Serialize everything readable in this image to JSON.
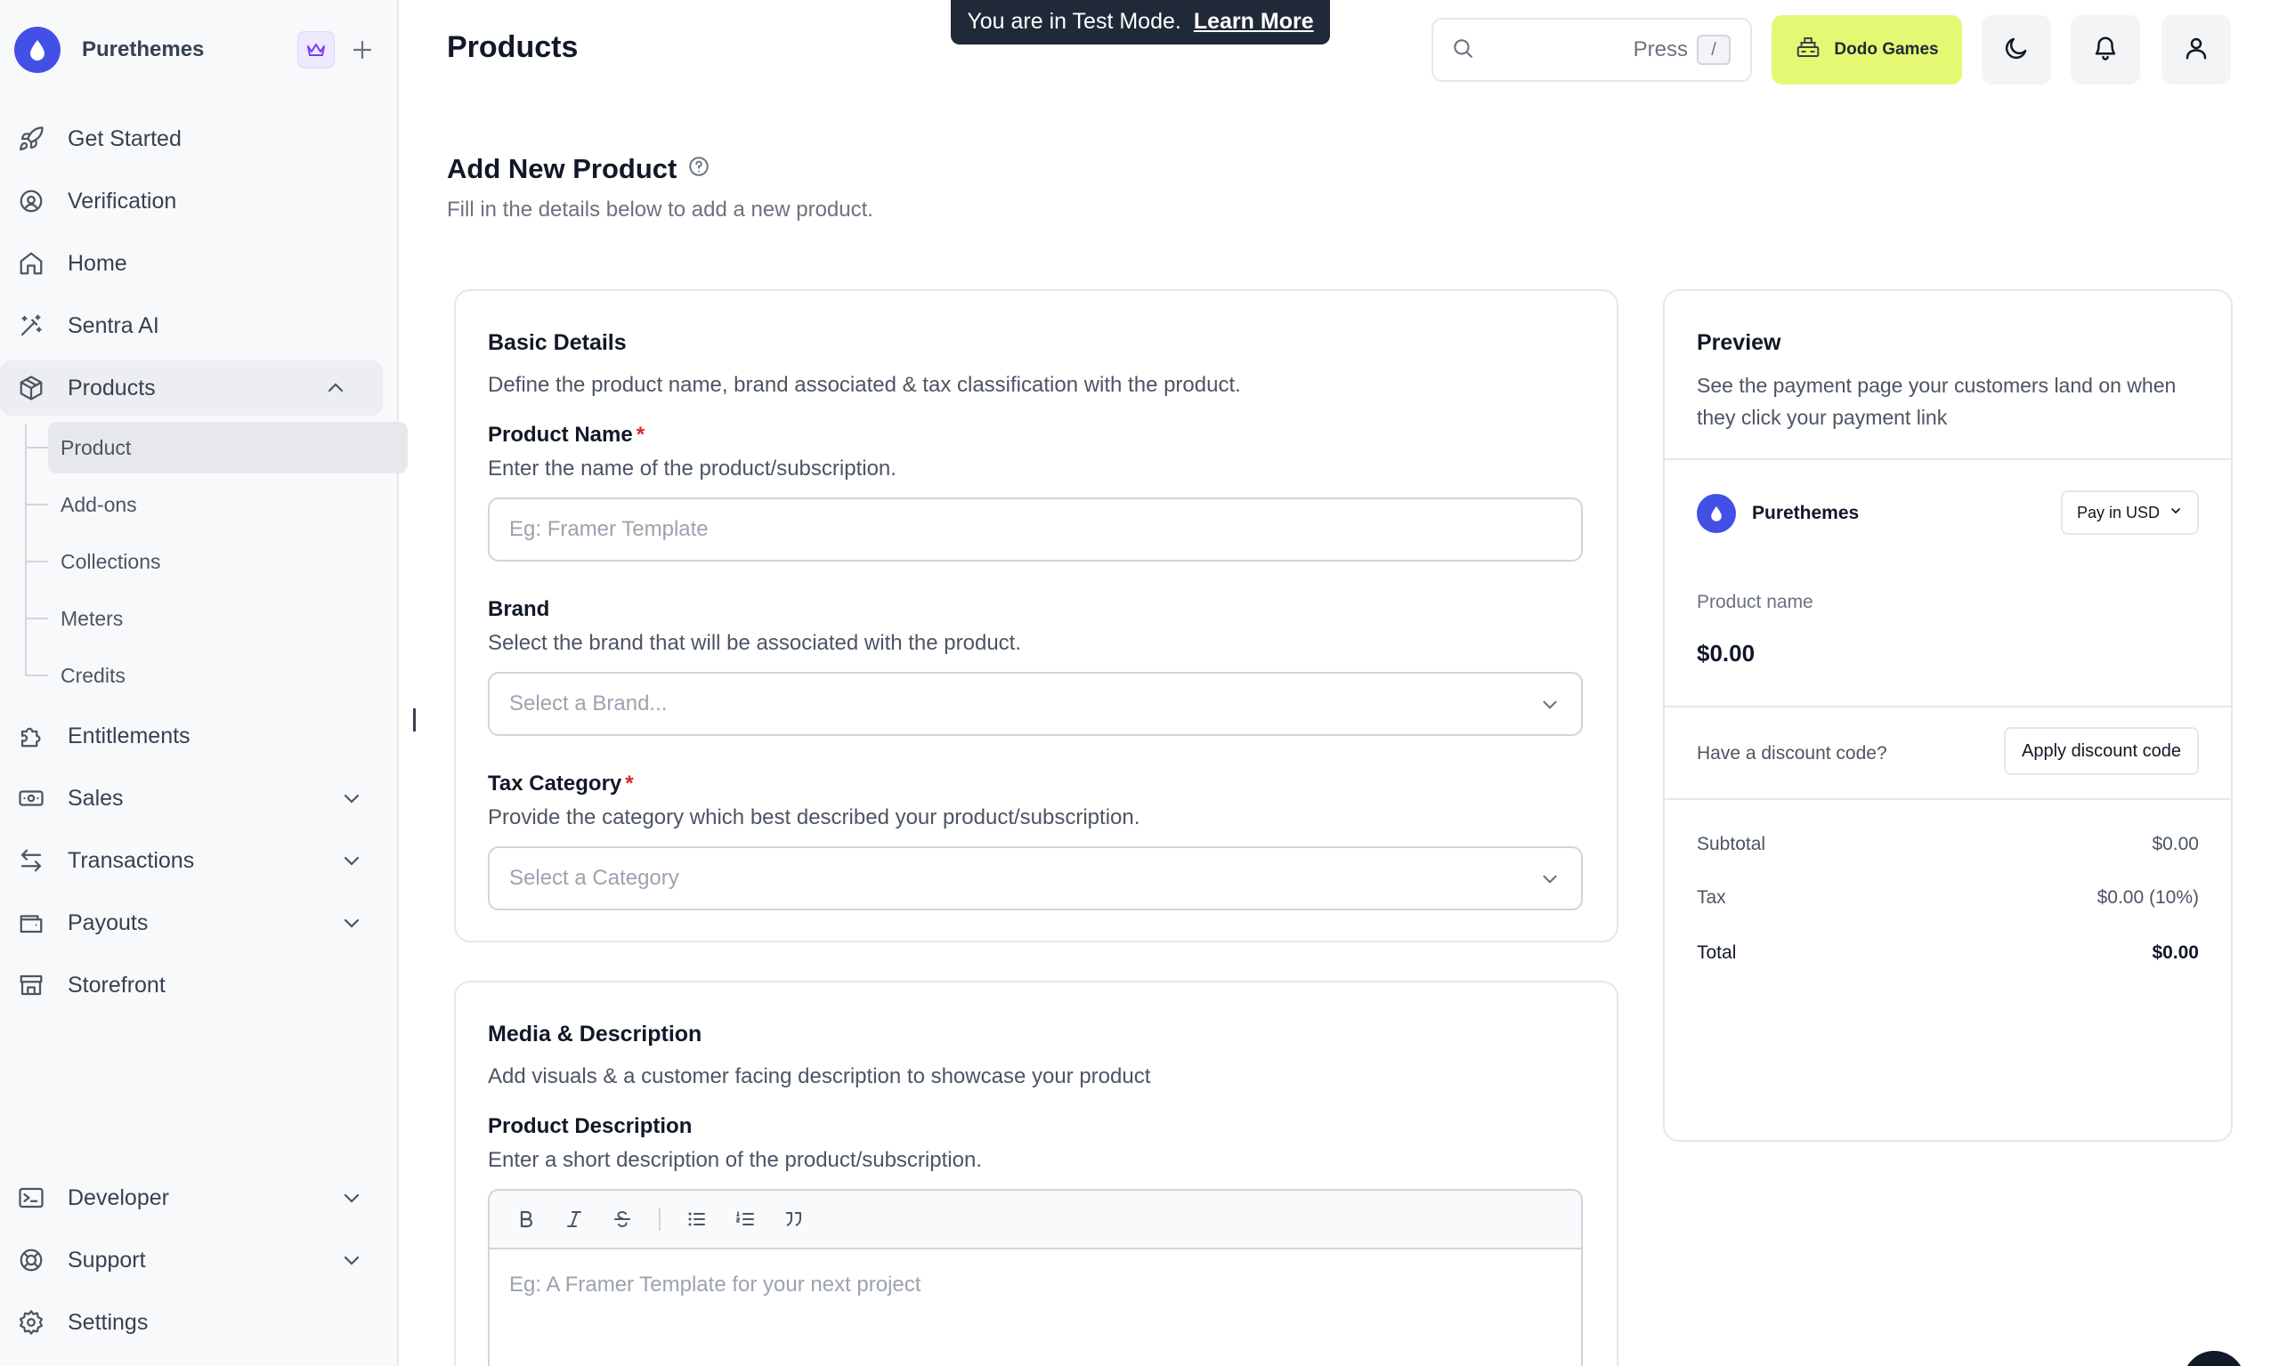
{
  "workspace": {
    "name": "Purethemes"
  },
  "sidebar": {
    "items": [
      {
        "label": "Get Started",
        "icon": "rocket-icon"
      },
      {
        "label": "Verification",
        "icon": "verification-icon"
      },
      {
        "label": "Home",
        "icon": "home-icon"
      },
      {
        "label": "Sentra AI",
        "icon": "magic-wand-icon"
      },
      {
        "label": "Products",
        "icon": "box-icon"
      },
      {
        "label": "Entitlements",
        "icon": "puzzle-icon"
      },
      {
        "label": "Sales",
        "icon": "banknote-icon"
      },
      {
        "label": "Transactions",
        "icon": "arrows-icon"
      },
      {
        "label": "Payouts",
        "icon": "wallet-icon"
      },
      {
        "label": "Storefront",
        "icon": "store-icon"
      },
      {
        "label": "Developer",
        "icon": "terminal-icon"
      },
      {
        "label": "Support",
        "icon": "lifebuoy-icon"
      },
      {
        "label": "Settings",
        "icon": "gear-icon"
      }
    ],
    "products_sub": [
      "Product",
      "Add-ons",
      "Collections",
      "Meters",
      "Credits"
    ]
  },
  "header": {
    "title": "Products",
    "toast_text": "You are in Test Mode.",
    "toast_link": "Learn More",
    "search_press": "Press",
    "search_key": "/",
    "brand_button": "Dodo Games"
  },
  "page": {
    "heading": "Add New Product",
    "subheading": "Fill in the details below to add a new product."
  },
  "basic": {
    "title": "Basic Details",
    "desc": "Define the product name, brand associated & tax classification with the product.",
    "name_label": "Product Name",
    "name_hint": "Enter the name of the product/subscription.",
    "name_placeholder": "Eg: Framer Template",
    "brand_label": "Brand",
    "brand_hint": "Select the brand that will be associated with the product.",
    "brand_placeholder": "Select a Brand...",
    "tax_label": "Tax Category",
    "tax_hint": "Provide the category which best described your product/subscription.",
    "tax_placeholder": "Select a Category",
    "required_mark": "*"
  },
  "media": {
    "title": "Media & Description",
    "desc": "Add visuals & a customer facing description to showcase your product",
    "desc_label": "Product Description",
    "desc_hint": "Enter a short description of the product/subscription.",
    "editor_placeholder": "Eg: A Framer Template for your next project"
  },
  "preview": {
    "title": "Preview",
    "desc": "See the payment page your customers land on when they click your payment link",
    "merchant": "Purethemes",
    "pay_in": "Pay in USD",
    "product_name": "Product name",
    "price": "$0.00",
    "discount_q": "Have a discount code?",
    "apply": "Apply discount code",
    "subtotal_label": "Subtotal",
    "subtotal": "$0.00",
    "tax_label": "Tax",
    "tax": "$0.00 (10%)",
    "total_label": "Total",
    "total": "$0.00"
  },
  "colors": {
    "accent": "#4350e6",
    "brand_button": "#e4f873",
    "required": "#dc2626"
  }
}
